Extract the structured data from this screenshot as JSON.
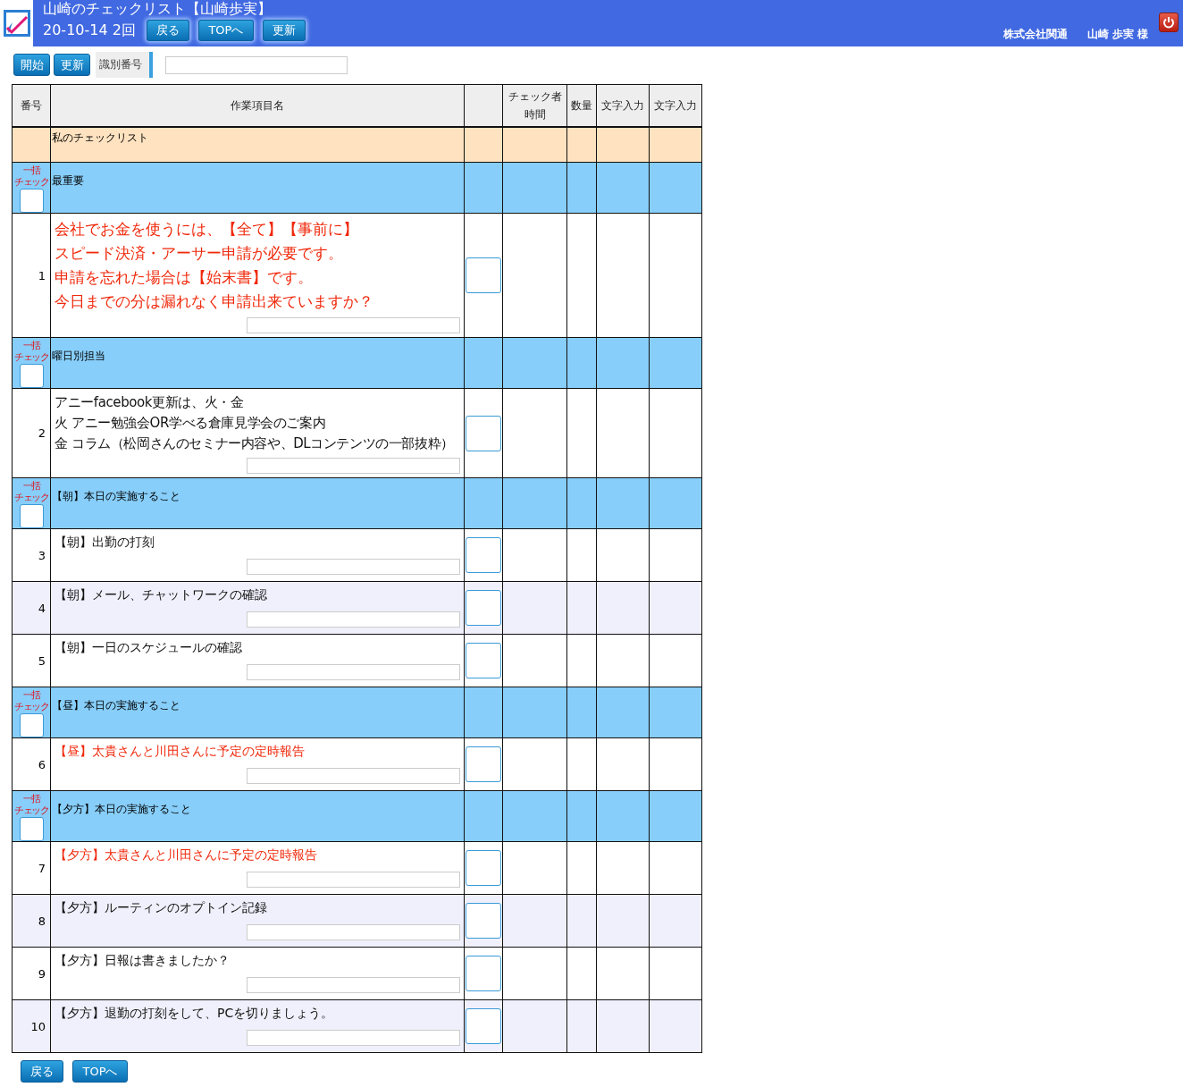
{
  "header": {
    "title": "山崎のチェックリスト【山崎歩実】",
    "date": "20-10-14 2回",
    "buttons": [
      "戻る",
      "TOPへ",
      "更新"
    ],
    "company": "株式会社関通",
    "user": "山崎 歩実 様"
  },
  "toolbar": {
    "buttons": [
      "開始",
      "更新"
    ],
    "label": "識別番号"
  },
  "table": {
    "columns": [
      [
        "番号"
      ],
      [
        "作業項目名"
      ],
      [
        "チェック者",
        "時間"
      ],
      [
        "数量"
      ],
      [
        "文字入力"
      ],
      [
        "文字入力"
      ]
    ],
    "rows": [
      {
        "kind": "title",
        "text": "私のチェックリスト"
      },
      {
        "kind": "group",
        "bulk_label": [
          "一括",
          "チェック"
        ],
        "text": "最重要",
        "checked": false
      },
      {
        "kind": "notice",
        "number": "1",
        "emphasis": true,
        "lines": [
          "会社でお金を使うには、【全て】【事前に】",
          "スピード決済・アーサー申請が必要です。",
          "申請を忘れた場合は【始末書】です。",
          "今日までの分は漏れなく申請出来ていますか？"
        ],
        "checked": false
      },
      {
        "kind": "group",
        "bulk_label": [
          "一括",
          "チェック"
        ],
        "text": "曜日別担当",
        "checked": false
      },
      {
        "kind": "detail",
        "number": "2",
        "emphasis": false,
        "lines": [
          "アニーfacebook更新は、火・金",
          "火 アニー勉強会OR学べる倉庫見学会のご案内",
          "金 コラム（松岡さんのセミナー内容や、DLコンテンツの一部抜粋）"
        ],
        "checked": false
      },
      {
        "kind": "group",
        "bulk_label": [
          "一括",
          "チェック"
        ],
        "text": "【朝】本日の実施すること",
        "checked": false
      },
      {
        "kind": "item",
        "number": "3",
        "emphasis": false,
        "lines": [
          "【朝】出勤の打刻"
        ],
        "checked": false
      },
      {
        "kind": "item",
        "number": "4",
        "emphasis": false,
        "lines": [
          "【朝】メール、チャットワークの確認"
        ],
        "checked": false
      },
      {
        "kind": "item",
        "number": "5",
        "emphasis": false,
        "lines": [
          "【朝】一日のスケジュールの確認"
        ],
        "checked": false
      },
      {
        "kind": "group",
        "bulk_label": [
          "一括",
          "チェック"
        ],
        "text": "【昼】本日の実施すること",
        "checked": false
      },
      {
        "kind": "item",
        "number": "6",
        "emphasis": true,
        "lines": [
          "【昼】太貴さんと川田さんに予定の定時報告"
        ],
        "checked": false
      },
      {
        "kind": "group",
        "bulk_label": [
          "一括",
          "チェック"
        ],
        "text": "【夕方】本日の実施すること",
        "checked": false
      },
      {
        "kind": "item",
        "number": "7",
        "emphasis": true,
        "lines": [
          "【夕方】太貴さんと川田さんに予定の定時報告"
        ],
        "checked": false
      },
      {
        "kind": "item",
        "number": "8",
        "emphasis": false,
        "lines": [
          "【夕方】ルーティンのオプトイン記録"
        ],
        "checked": false
      },
      {
        "kind": "item",
        "number": "9",
        "emphasis": false,
        "lines": [
          "【夕方】日報は書きましたか？"
        ],
        "checked": false
      },
      {
        "kind": "item",
        "number": "10",
        "emphasis": false,
        "lines": [
          "【夕方】退勤の打刻をして、PCを切りましょう。"
        ],
        "checked": false
      }
    ]
  },
  "footer": {
    "buttons": [
      "戻る",
      "TOPへ"
    ]
  }
}
